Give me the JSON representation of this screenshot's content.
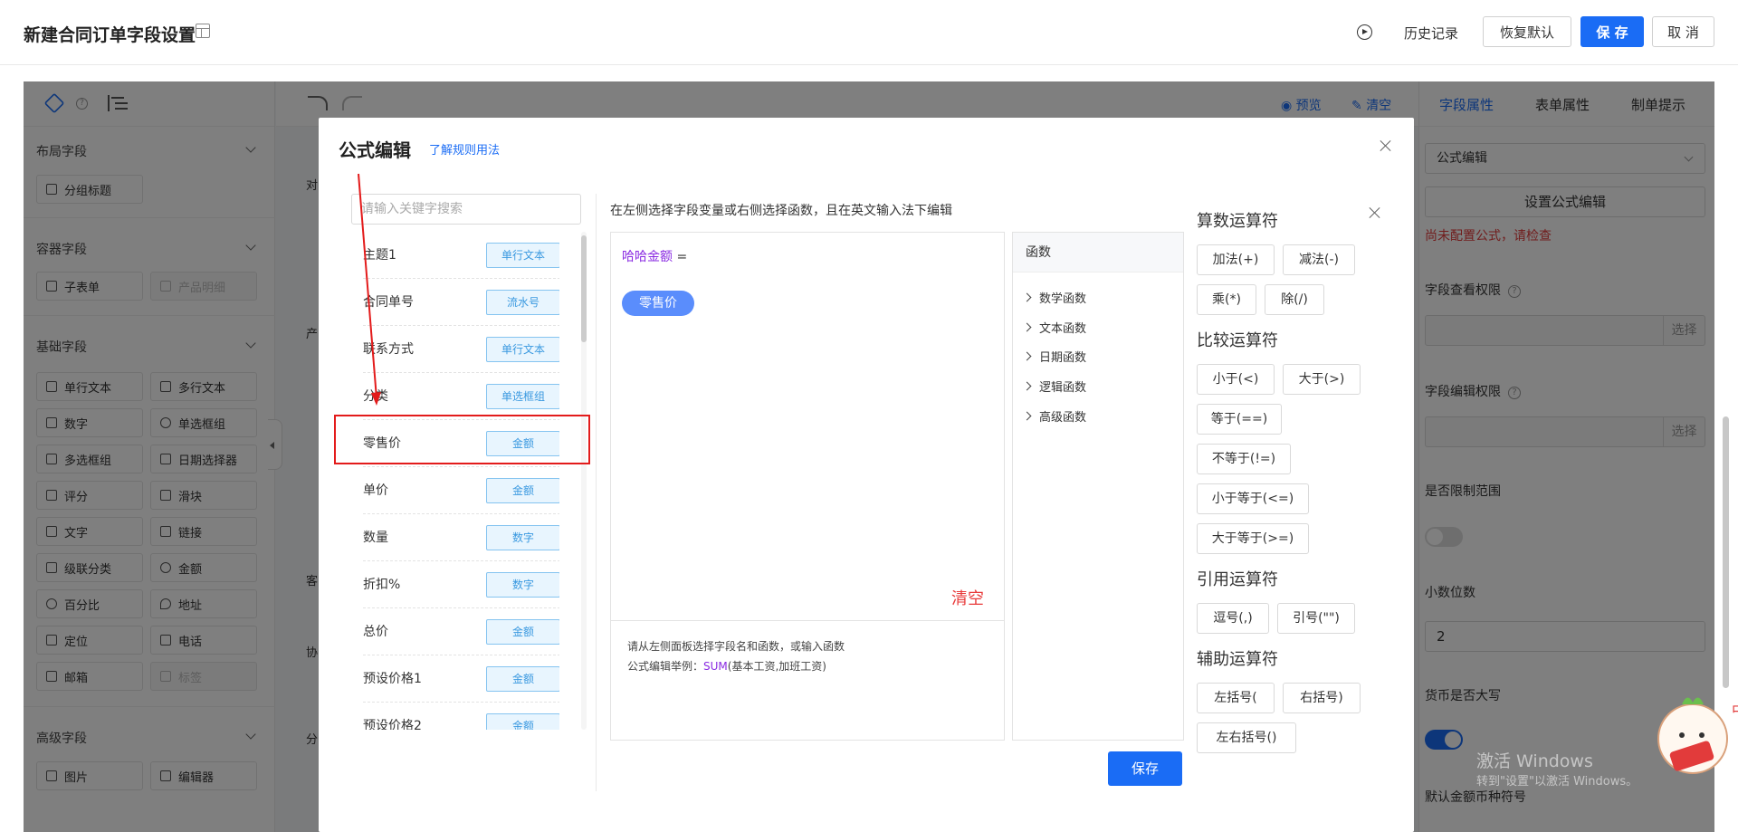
{
  "header": {
    "title": "新建合同订单字段设置",
    "history_label": "历史记录",
    "restore_label": "恢复默认",
    "save_label": "保 存",
    "cancel_label": "取 消"
  },
  "left_panel": {
    "sections": [
      {
        "title": "布局字段",
        "items": [
          "分组标题"
        ]
      },
      {
        "title": "容器字段",
        "items": [
          "子表单",
          "产品明细"
        ]
      },
      {
        "title": "基础字段",
        "items": [
          "单行文本",
          "多行文本",
          "数字",
          "单选框组",
          "多选框组",
          "日期选择器",
          "评分",
          "滑块",
          "文字",
          "链接",
          "级联分类",
          "金额",
          "百分比",
          "地址",
          "定位",
          "电话",
          "邮箱",
          "标签"
        ]
      },
      {
        "title": "高级字段",
        "items": [
          "图片",
          "编辑器"
        ]
      }
    ]
  },
  "canvas": {
    "preview_label": "预览",
    "clear_label": "清空",
    "fields": [
      "对",
      "产",
      "客",
      "协",
      "分"
    ]
  },
  "right_panel": {
    "tabs": [
      "字段属性",
      "表单属性",
      "制单提示"
    ],
    "type_select": "公式编辑",
    "set_formula_label": "设置公式编辑",
    "error_text": "尚未配置公式，请检查",
    "view_permission_label": "字段查看权限",
    "edit_permission_label": "字段编辑权限",
    "select_label": "选择",
    "limit_range_label": "是否限制范围",
    "decimal_label": "小数位数",
    "decimal_value": "2",
    "uppercase_label": "货币是否大写",
    "default_currency_label": "默认金额币种符号"
  },
  "modal": {
    "title": "公式编辑",
    "rules_link": "了解规则用法",
    "search_placeholder": "请输入关键字搜索",
    "fields": [
      {
        "name": "主题1",
        "type": "单行文本"
      },
      {
        "name": "合同单号",
        "type": "流水号"
      },
      {
        "name": "联系方式",
        "type": "单行文本"
      },
      {
        "name": "分类",
        "type": "单选框组"
      },
      {
        "name": "零售价",
        "type": "金额"
      },
      {
        "name": "单价",
        "type": "金额"
      },
      {
        "name": "数量",
        "type": "数字"
      },
      {
        "name": "折扣%",
        "type": "数字"
      },
      {
        "name": "总价",
        "type": "金额"
      },
      {
        "name": "预设价格1",
        "type": "金额"
      },
      {
        "name": "预设价格2",
        "type": "金额"
      }
    ],
    "editor_hint": "在左侧选择字段变量或右侧选择函数，且在英文输入法下编辑",
    "formula_target": "哈哈金额",
    "formula_equals": "=",
    "formula_chip": "零售价",
    "clear_label": "清空",
    "tip_line1": "请从左侧面板选择字段名和函数，或输入函数",
    "tip_prefix": "公式编辑举例：",
    "tip_sum": "SUM",
    "tip_suffix": "(基本工资,加班工资)",
    "functions_title": "函数",
    "functions": [
      "数学函数",
      "文本函数",
      "日期函数",
      "逻辑函数",
      "高级函数"
    ],
    "ops": {
      "arith_title": "算数运算符",
      "arith": [
        "加法(+)",
        "减法(-)",
        "乘(*)",
        "除(/)"
      ],
      "compare_title": "比较运算符",
      "compare": [
        "小于(<)",
        "大于(>)",
        "等于(==)",
        "不等于(!=)",
        "小于等于(<=)",
        "大于等于(>=)"
      ],
      "ref_title": "引用运算符",
      "ref": [
        "逗号(,)",
        "引号(\"\")"
      ],
      "aux_title": "辅助运算符",
      "aux": [
        "左括号(",
        "右括号)",
        "左右括号()"
      ]
    },
    "save_label": "保存"
  },
  "watermark": {
    "line1": "激活 Windows",
    "line2": "转到\"设置\"以激活 Windows。"
  },
  "colors": {
    "primary": "#1a6cf5",
    "annotation": "#e31b1b",
    "tag_text": "#3a99e0",
    "formula_chip": "#5a8dfc",
    "error": "#e23b3b"
  }
}
